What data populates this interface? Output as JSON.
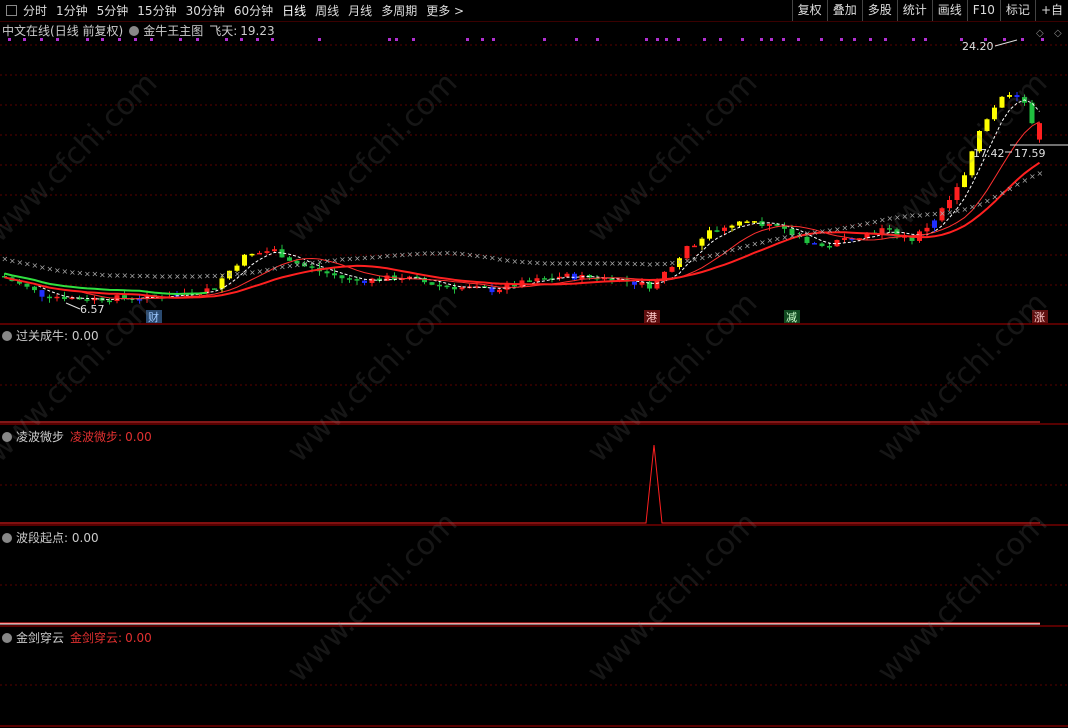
{
  "toolbar": {
    "periods": [
      "分时",
      "1分钟",
      "5分钟",
      "15分钟",
      "30分钟",
      "60分钟",
      "日线",
      "周线",
      "月线",
      "多周期",
      "更多 >"
    ],
    "active_period": "日线",
    "right_buttons": [
      "复权",
      "叠加",
      "多股",
      "统计",
      "画线",
      "F10",
      "标记",
      "+自"
    ]
  },
  "main": {
    "stock_name": "中文在线",
    "mode": "(日线 前复权)",
    "indicator": "金牛王主图",
    "feitian_label": "飞天:",
    "feitian_value": "19.23",
    "high_label": "24.20",
    "low_label": "6.57",
    "mid_label_left": "17.42",
    "mid_label_right": "17.59",
    "markers": [
      "财",
      "港",
      "减",
      "涨"
    ]
  },
  "subcharts": [
    {
      "name": "过关成牛",
      "value_text": ": 0.00",
      "colored": false
    },
    {
      "name": "凌波微步",
      "value_name": "凌波微步:",
      "value": "0.00",
      "colored": true
    },
    {
      "name": "波段起点",
      "value_text": ": 0.00",
      "colored": false
    },
    {
      "name": "金剑穿云",
      "value_name": "金剑穿云:",
      "value": "0.00",
      "colored": true
    }
  ],
  "watermark": "www.cfchi.com",
  "colors": {
    "up": "#ff3030",
    "down": "#30d040",
    "yellow": "#ffff00",
    "blue": "#3030ff",
    "grid": "#5a0000"
  }
}
